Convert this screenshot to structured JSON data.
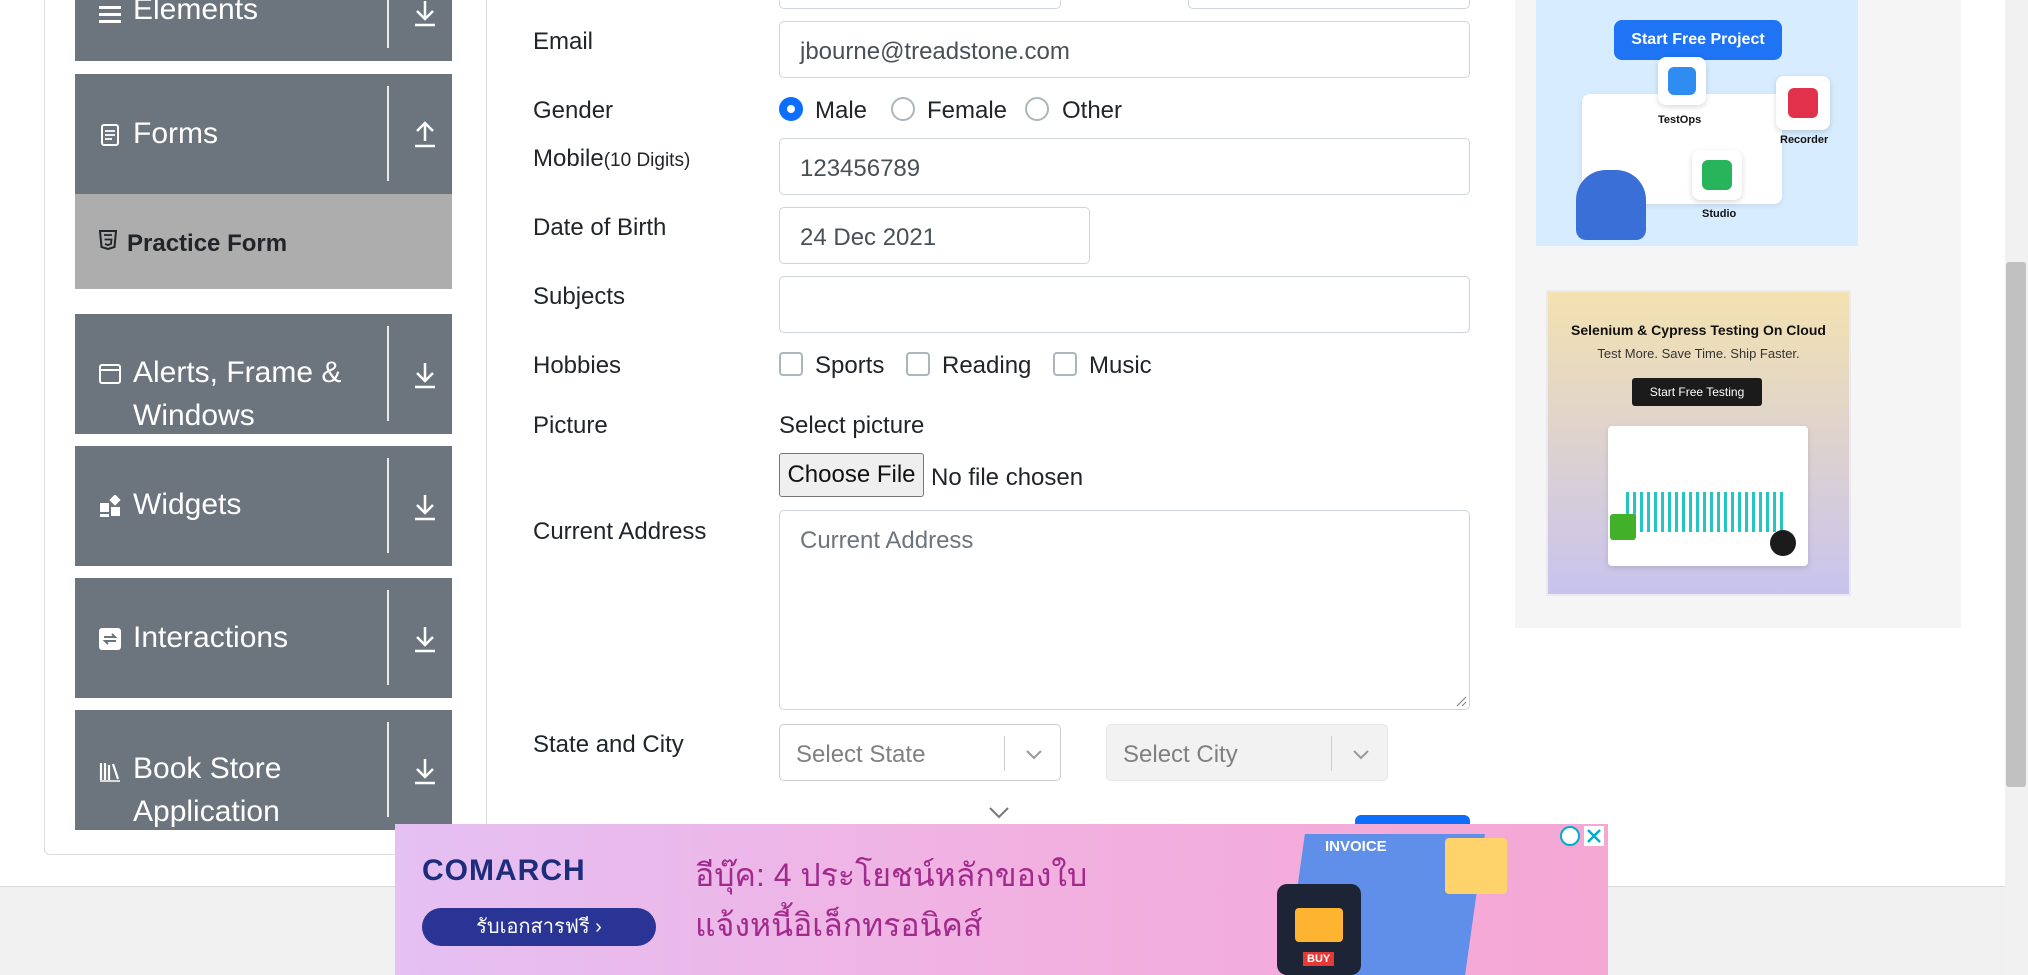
{
  "sidebar": {
    "groups": [
      {
        "label": "Elements"
      },
      {
        "label": "Forms"
      },
      {
        "label": "Alerts, Frame & Windows"
      },
      {
        "label": "Widgets"
      },
      {
        "label": "Interactions"
      },
      {
        "label": "Book Store Application"
      }
    ],
    "active_item": "Practice Form"
  },
  "form": {
    "email": {
      "label": "Email",
      "value": "jbourne@treadstone.com"
    },
    "gender": {
      "label": "Gender",
      "options": [
        "Male",
        "Female",
        "Other"
      ],
      "selected": "Male"
    },
    "mobile": {
      "label": "Mobile",
      "hint": "(10 Digits)",
      "value": "123456789"
    },
    "dob": {
      "label": "Date of Birth",
      "value": "24 Dec 2021"
    },
    "subjects": {
      "label": "Subjects",
      "value": ""
    },
    "hobbies": {
      "label": "Hobbies",
      "options": [
        "Sports",
        "Reading",
        "Music"
      ]
    },
    "picture": {
      "label": "Picture",
      "select_text": "Select picture",
      "button": "Choose File",
      "status": "No file chosen"
    },
    "address": {
      "label": "Current Address",
      "placeholder": "Current Address"
    },
    "state_city": {
      "label": "State and City",
      "state_placeholder": "Select State",
      "city_placeholder": "Select City"
    }
  },
  "ads": {
    "ad1": {
      "button": "Start Free Project",
      "tools": [
        "TestOps",
        "Recorder",
        "Studio"
      ]
    },
    "ad2": {
      "title": "Selenium & Cypress Testing On Cloud",
      "subtitle": "Test More. Save Time. Ship Faster.",
      "button": "Start Free Testing"
    },
    "bottom": {
      "brand": "COMARCH",
      "cta": "รับเอกสารฟรี ›",
      "headline1": "อีบุ๊ค: 4 ประโยชน์หลักของใบ",
      "headline2": "แจ้งหนี้อิเล็กทรอนิคส์",
      "badge": "INVOICE",
      "buy": "BUY"
    }
  },
  "colors": {
    "sidebar_bg": "#6c757d",
    "active_bg": "#adadad",
    "primary": "#0d6efd"
  }
}
